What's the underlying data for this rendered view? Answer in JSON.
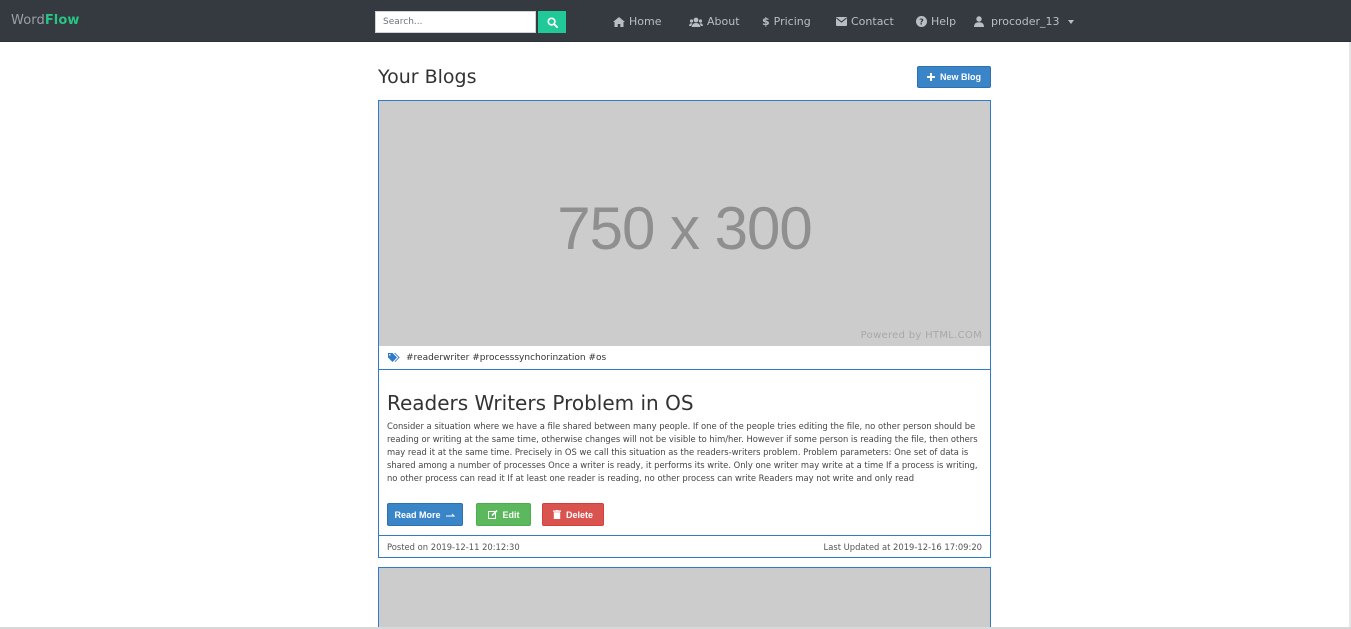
{
  "navbar": {
    "brand_part1": "Word",
    "brand_part2": "Flow",
    "search_placeholder": "Search...",
    "links": [
      {
        "label": "Home",
        "icon": "home-icon"
      },
      {
        "label": "About",
        "icon": "users-icon"
      },
      {
        "label": "Pricing",
        "icon": "dollar-icon"
      },
      {
        "label": "Contact",
        "icon": "envelope-icon"
      },
      {
        "label": "Help",
        "icon": "question-circle-icon"
      }
    ],
    "user": {
      "label": "procoder_13",
      "icon": "user-icon"
    }
  },
  "page": {
    "title": "Your Blogs",
    "new_blog_label": "New Blog"
  },
  "blogs": [
    {
      "image_text": "750 x 300",
      "image_credit": "Powered by HTML.COM",
      "tags": "#readerwriter #processsynchorinzation #os",
      "title": "Readers Writers Problem in OS",
      "excerpt": "Consider a situation where we have a file shared between many people. If one of the people tries editing the file, no other person should be reading or writing at the same time, otherwise changes will not be visible to him/her. However if some person is reading the file, then others may read it at the same time. Precisely in OS we call this situation as the readers-writers problem. Problem parameters: One set of data is shared among a number of processes Once a writer is ready, it performs its write. Only one writer may write at a time If a process is writing, no other process can read it If at least one reader is reading, no other process can write Readers may not write and only read",
      "read_more_label": "Read More",
      "edit_label": "Edit",
      "delete_label": "Delete",
      "posted": "Posted on 2019-12-11 20:12:30",
      "updated": "Last Updated at 2019-12-16 17:09:20"
    }
  ],
  "colors": {
    "navbar_bg": "#343a40",
    "brand_accent": "#27c484",
    "search_button": "#20c997",
    "primary": "#3a85c8",
    "success": "#5cb85c",
    "danger": "#d9534f",
    "card_border": "#2f7ac9"
  }
}
